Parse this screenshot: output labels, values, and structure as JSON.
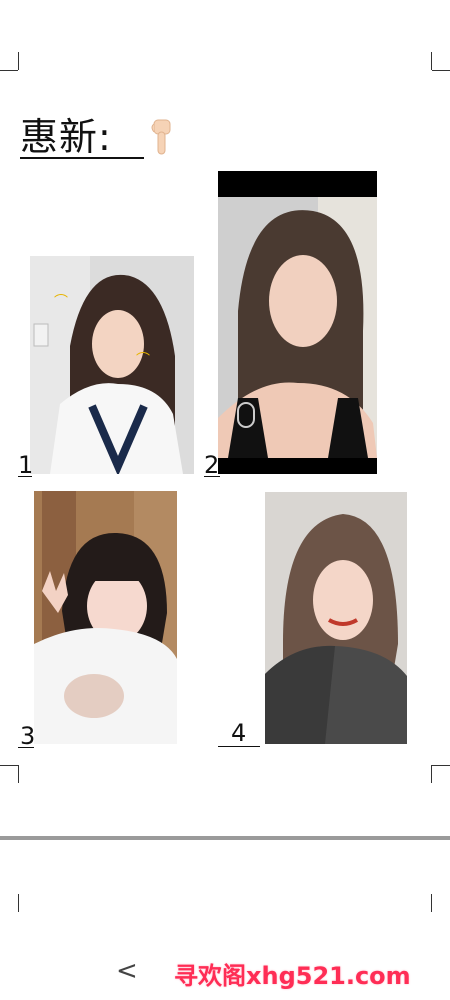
{
  "document": {
    "title": "惠新:",
    "title_emoji": "pointing-down-hand-icon"
  },
  "photos": [
    {
      "number": "1",
      "subject": "photo-woman-white-top"
    },
    {
      "number": "2",
      "subject": "photo-woman-black-top"
    },
    {
      "number": "3",
      "subject": "photo-woman-bob-peace-sign"
    },
    {
      "number": "4",
      "subject": "photo-woman-denim-jacket"
    }
  ],
  "footer": {
    "back_symbol": "<",
    "watermark": "寻欢阁xhg521.com"
  },
  "colors": {
    "divider": "#9a9a9a",
    "watermark": "#ff2d55"
  }
}
